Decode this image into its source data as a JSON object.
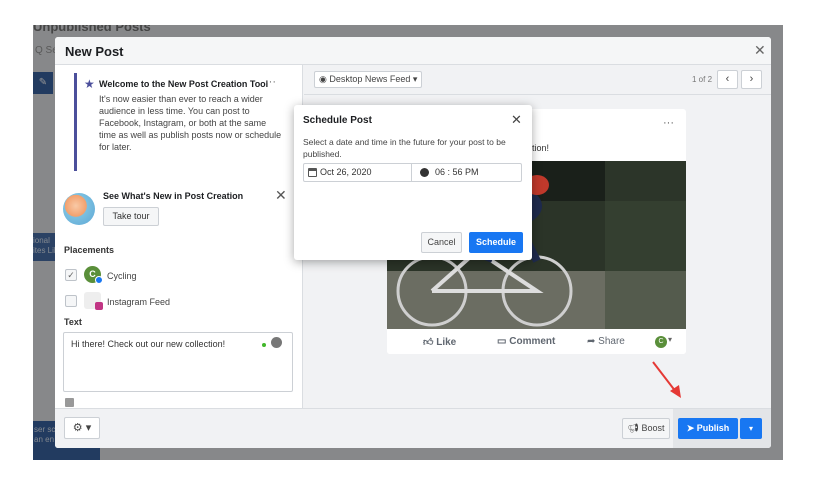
{
  "background": {
    "page_title": "Unpublished Posts",
    "search_placeholder": "Q Se",
    "left_snippet": "ional\nites Lik",
    "bottom_snippet": "ser sc\nan en"
  },
  "modal": {
    "title": "New Post",
    "close_icon": "close-icon",
    "welcome": {
      "title": "Welcome to the New Post Creation Tool",
      "body": "It's now easier than ever to reach a wider audience in less time. You can post to Facebook, Instagram, or both at the same time as well as publish posts now or schedule for later.",
      "menu": "···"
    },
    "whats_new": {
      "title": "See What's New in Post Creation",
      "button": "Take tour"
    },
    "placements": {
      "heading": "Placements",
      "items": [
        {
          "label": "Cycling",
          "avatar": "C"
        },
        {
          "label": "Instagram Feed"
        }
      ]
    },
    "text_section": {
      "heading": "Text",
      "value": "Hi there! Check out our new collection!"
    },
    "preview": {
      "feed_select": "Desktop News Feed",
      "pager": "1 of 2",
      "post_text": "tion!",
      "post_menu": "···",
      "actions": {
        "like": "Like",
        "comment": "Comment",
        "share": "Share"
      }
    },
    "footer": {
      "boost": "Boost",
      "publish": "Publish"
    }
  },
  "schedule_dialog": {
    "title": "Schedule Post",
    "description": "Select a date and time in the future for your post to be published.",
    "date": "Oct 26, 2020",
    "time": "06 : 56 PM",
    "cancel": "Cancel",
    "schedule": "Schedule"
  },
  "colors": {
    "primary": "#1877f2",
    "annotation_arrow": "#e53935"
  }
}
